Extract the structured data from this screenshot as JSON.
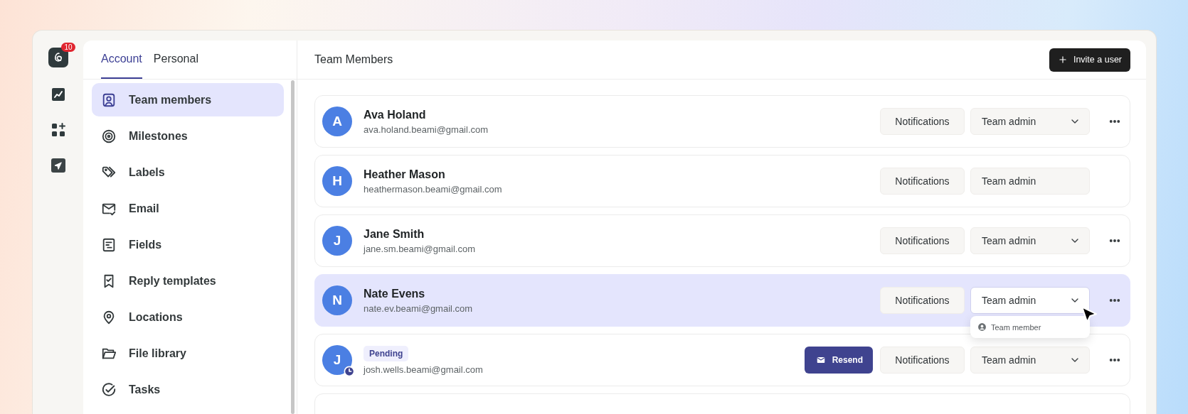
{
  "rail": {
    "badge": "10"
  },
  "tabs": [
    {
      "label": "Account",
      "selected": true
    },
    {
      "label": "Personal",
      "selected": false
    }
  ],
  "sidebar": {
    "items": [
      {
        "label": "Team members",
        "selected": true
      },
      {
        "label": "Milestones",
        "selected": false
      },
      {
        "label": "Labels",
        "selected": false
      },
      {
        "label": "Email",
        "selected": false
      },
      {
        "label": "Fields",
        "selected": false
      },
      {
        "label": "Reply templates",
        "selected": false
      },
      {
        "label": "Locations",
        "selected": false
      },
      {
        "label": "File library",
        "selected": false
      },
      {
        "label": "Tasks",
        "selected": false
      }
    ]
  },
  "header": {
    "title": "Team Members",
    "invite_button": "Invite a user"
  },
  "members": [
    {
      "kind": "member",
      "initial": "A",
      "name": "Ava Holand",
      "email": "ava.holand.beami@gmail.com",
      "selected": false,
      "notifications": "Notifications",
      "role": "Team admin",
      "editable": true,
      "expanded": false
    },
    {
      "kind": "member",
      "initial": "H",
      "name": "Heather Mason",
      "email": "heathermason.beami@gmail.com",
      "selected": false,
      "notifications": "Notifications",
      "role": "Team admin",
      "editable": false,
      "expanded": false
    },
    {
      "kind": "member",
      "initial": "J",
      "name": "Jane Smith",
      "email": "jane.sm.beami@gmail.com",
      "selected": false,
      "notifications": "Notifications",
      "role": "Team admin",
      "editable": true,
      "expanded": false
    },
    {
      "kind": "member",
      "initial": "N",
      "name": "Nate Evens",
      "email": "nate.ev.beami@gmail.com",
      "selected": true,
      "notifications": "Notifications",
      "role": "Team admin",
      "editable": true,
      "expanded": true,
      "options": [
        "Team member"
      ]
    },
    {
      "kind": "pending",
      "initial": "J",
      "badge": "Pending",
      "email": "josh.wells.beami@gmail.com",
      "selected": false,
      "resend": "Resend",
      "notifications": "Notifications",
      "role": "Team admin",
      "editable": true,
      "expanded": false
    }
  ]
}
